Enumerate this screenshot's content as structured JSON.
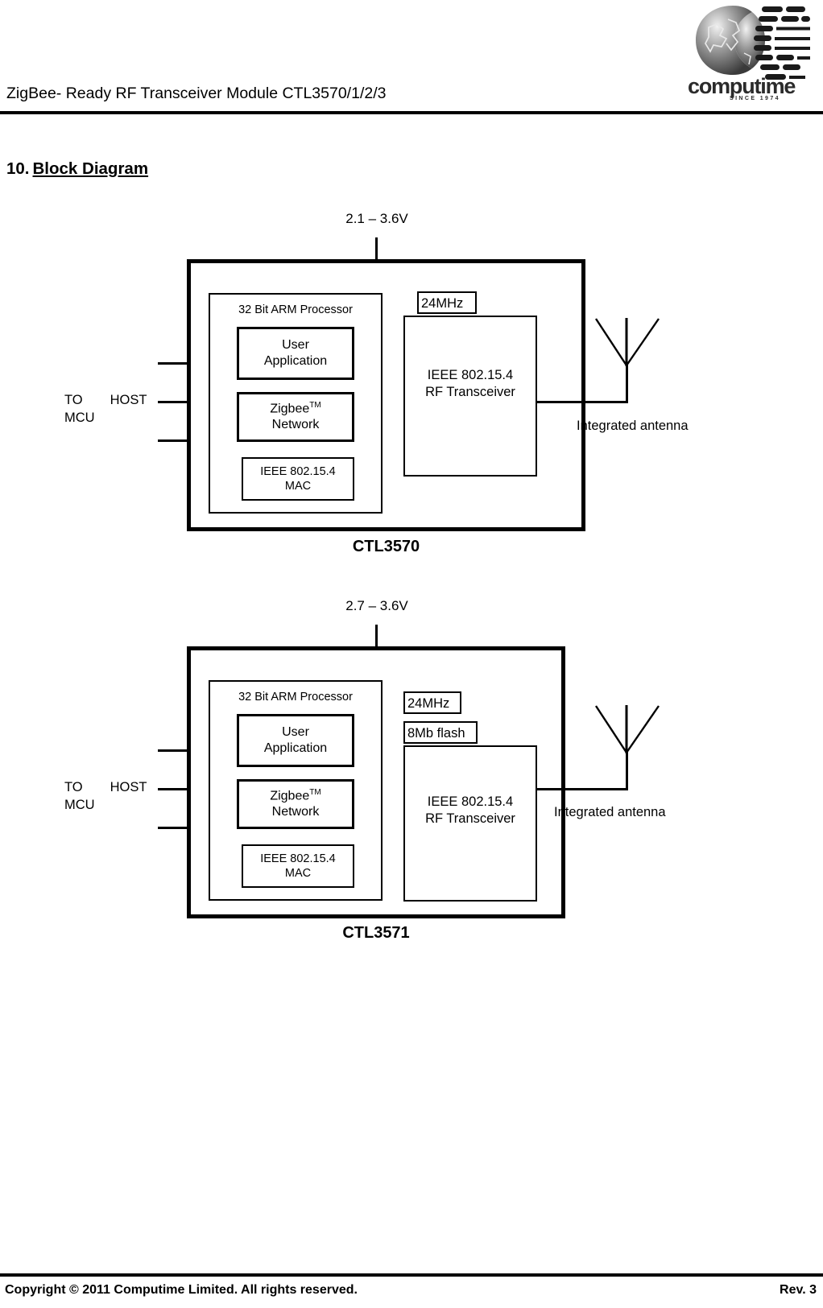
{
  "header": {
    "title": "ZigBee- Ready RF Transceiver Module CTL3570/1/2/3",
    "logo_wordmark": "computime",
    "logo_tagline": "SINCE 1974"
  },
  "section": {
    "number": "10.",
    "title": "Block Diagram"
  },
  "diagrams": [
    {
      "part_label": "CTL3570",
      "voltage": "2.1 – 3.6V",
      "host_line1": "TO",
      "host_line2": "HOST",
      "host_line3": "MCU",
      "mcu_title": "32 Bit ARM Processor",
      "stack": [
        {
          "line1": "User",
          "line2": "Application",
          "tm": ""
        },
        {
          "line1": "Zigbee",
          "line2": "Network",
          "tm": "TM"
        },
        {
          "line1": "IEEE 802.15.4",
          "line2": "MAC",
          "tm": ""
        }
      ],
      "crystal": "24MHz",
      "flash": null,
      "rf_line1": "IEEE 802.15.4",
      "rf_line2": "RF Transceiver",
      "antenna_label": "Integrated antenna"
    },
    {
      "part_label": "CTL3571",
      "voltage": "2.7 – 3.6V",
      "host_line1": "TO",
      "host_line2": "HOST",
      "host_line3": "MCU",
      "mcu_title": "32 Bit ARM Processor",
      "stack": [
        {
          "line1": "User",
          "line2": "Application",
          "tm": ""
        },
        {
          "line1": "Zigbee",
          "line2": "Network",
          "tm": "TM"
        },
        {
          "line1": "IEEE 802.15.4",
          "line2": "MAC",
          "tm": ""
        }
      ],
      "crystal": "24MHz",
      "flash": "8Mb flash",
      "rf_line1": "IEEE 802.15.4",
      "rf_line2": "RF Transceiver",
      "antenna_label": "Integrated antenna"
    }
  ],
  "footer": {
    "copyright": "Copyright © 2011 Computime Limited. All rights reserved.",
    "revision": "Rev. 3"
  }
}
